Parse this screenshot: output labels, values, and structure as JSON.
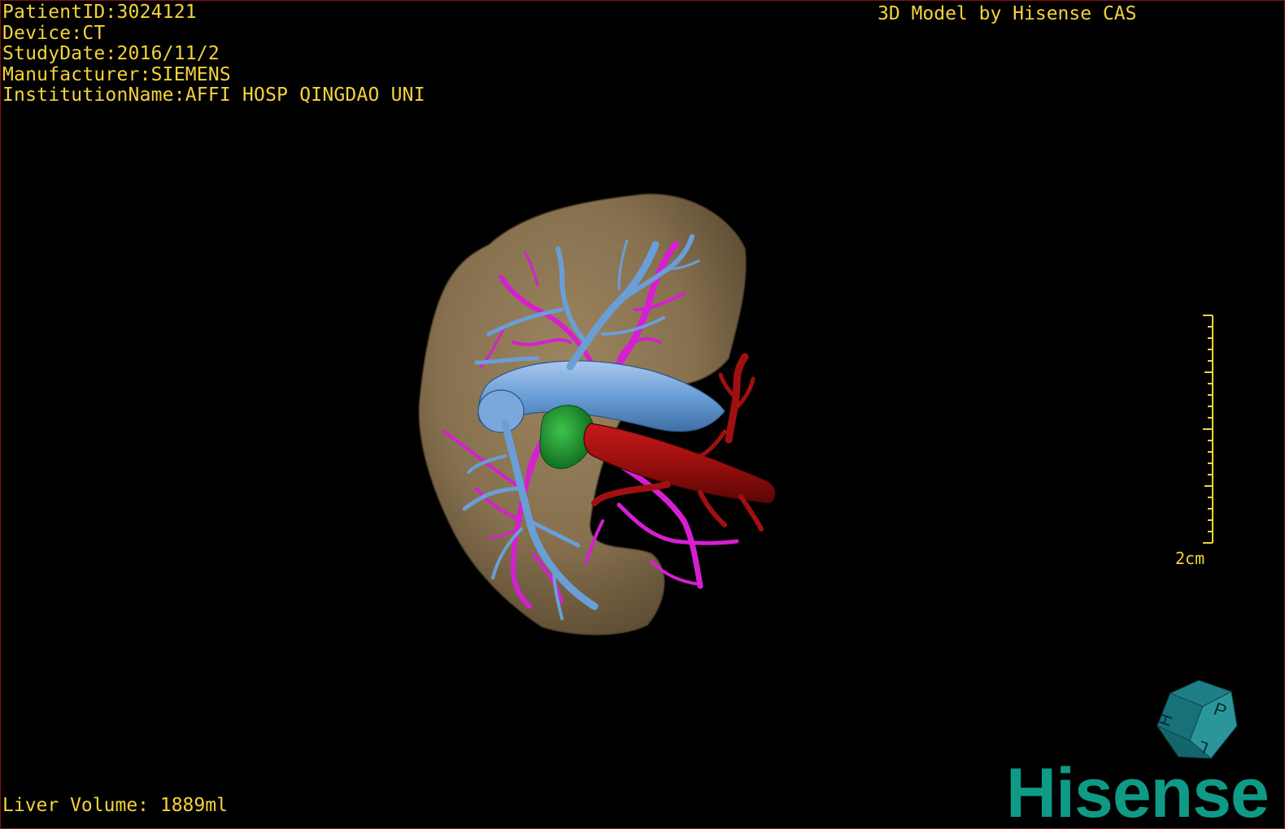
{
  "info": {
    "patient_id": "PatientID:3024121",
    "device": "Device:CT",
    "study_date": "StudyDate:2016/11/2",
    "manufacturer": "Manufacturer:SIEMENS",
    "institution": "InstitutionName:AFFI HOSP QINGDAO UNI"
  },
  "model_title": "3D Model by Hisense CAS",
  "liver_volume": "Liver Volume: 1889ml",
  "scale_bar": {
    "label": "2cm"
  },
  "orientation_cube": {
    "icon": "orientation-cube-icon",
    "face_letters": [
      "P",
      "H",
      "L"
    ]
  },
  "brand": {
    "logo_text": "Hisense"
  },
  "colors": {
    "overlay_text": "#f3d33a",
    "liver": "#86704e",
    "portal_vein": "#6a9ed6",
    "hepatic_artery": "#d51fd0",
    "aorta": "#a01010",
    "gallbladder": "#1e9a2e",
    "brand": "#0f9a86",
    "border": "#8a1010"
  }
}
